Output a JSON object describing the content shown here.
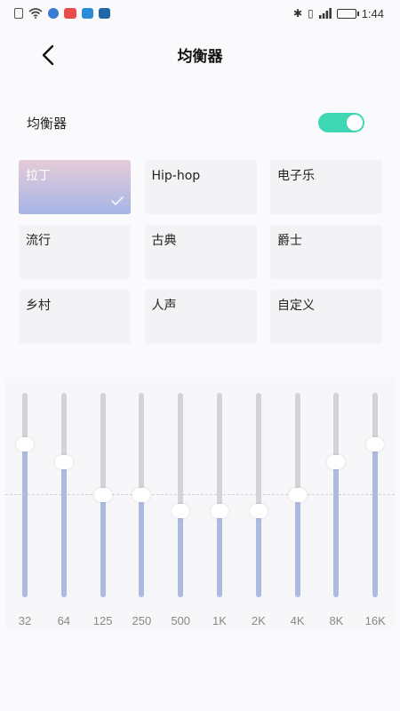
{
  "status_bar": {
    "time": "1:44",
    "icons": [
      "alert-icon",
      "wifi-icon",
      "music-app-icon",
      "red-app-icon",
      "sync-app-icon",
      "chat-app-icon"
    ],
    "right_icons": [
      "bluetooth-icon",
      "vibrate-icon",
      "signal-icon",
      "battery-icon"
    ]
  },
  "header": {
    "title": "均衡器"
  },
  "toggle": {
    "label": "均衡器",
    "on": true,
    "color": "#3ed6b3"
  },
  "presets": [
    {
      "label": "拉丁",
      "selected": true
    },
    {
      "label": "Hip-hop",
      "selected": false
    },
    {
      "label": "电子乐",
      "selected": false
    },
    {
      "label": "流行",
      "selected": false
    },
    {
      "label": "古典",
      "selected": false
    },
    {
      "label": "爵士",
      "selected": false
    },
    {
      "label": "乡村",
      "selected": false
    },
    {
      "label": "人声",
      "selected": false
    },
    {
      "label": "自定义",
      "selected": false
    }
  ],
  "equalizer": {
    "accent": "#aebae0",
    "bands": [
      {
        "freq": "32",
        "level": 0.75
      },
      {
        "freq": "64",
        "level": 0.66
      },
      {
        "freq": "125",
        "level": 0.5
      },
      {
        "freq": "250",
        "level": 0.5
      },
      {
        "freq": "500",
        "level": 0.42
      },
      {
        "freq": "1K",
        "level": 0.42
      },
      {
        "freq": "2K",
        "level": 0.42
      },
      {
        "freq": "4K",
        "level": 0.5
      },
      {
        "freq": "8K",
        "level": 0.66
      },
      {
        "freq": "16K",
        "level": 0.75
      }
    ]
  }
}
